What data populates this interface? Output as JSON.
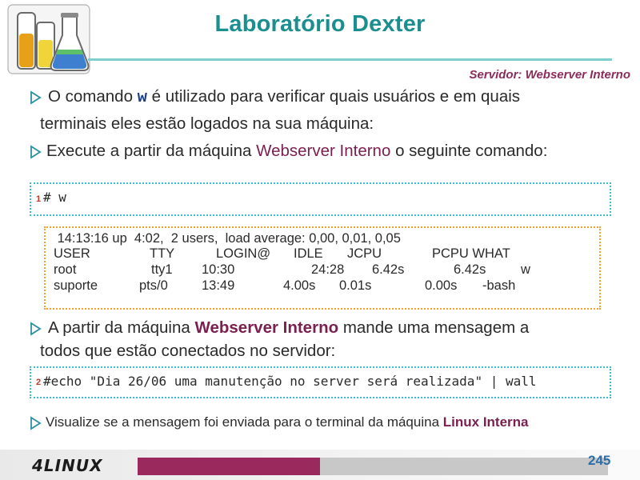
{
  "title": "Laboratório Dexter",
  "server_label": "Servidor: Webserver Interno",
  "bullets": {
    "b1": {
      "pre": "O comando ",
      "cmd": "w",
      "post1": " é utilizado para verificar quais usuários e em quais",
      "line2": "terminais eles estão logados na sua máquina:"
    },
    "b2": {
      "pre": "Execute a partir da máquina ",
      "highlight": "Webserver Interno",
      "post": " o seguinte comando:"
    },
    "b3": {
      "pre": "A partir da máquina  ",
      "highlight": "Webserver Interno",
      "post": " mande uma mensagem a",
      "line2": "todos que estão conectados no servidor:"
    },
    "b4": {
      "pre": "Visualize se a mensagem foi enviada para o terminal da máquina ",
      "highlight": "Linux Interna"
    }
  },
  "command1": {
    "number": "1",
    "code": "# w"
  },
  "output": {
    "header": " 14:13:16 up  4:02,  2 users,  load average: 0,00, 0,01, 0,05",
    "columns": [
      "USER",
      "TTY",
      "LOGIN@",
      "IDLE",
      "JCPU",
      "PCPU WHAT"
    ],
    "rows": [
      [
        "root",
        "tty1",
        "10:30",
        "24:28",
        "6.42s",
        "6.42s",
        "w"
      ],
      [
        "suporte",
        "pts/0",
        "13:49",
        "4.00s",
        "0.01s",
        "0.00s",
        "-bash"
      ]
    ]
  },
  "command2": {
    "number": "2",
    "code": "#echo \"Dia 26/06 uma manutenção no server será realizada\" | wall"
  },
  "footer": {
    "logo_text": "4LINUX",
    "page_number": "245"
  },
  "colors": {
    "title": "#1b8f8f",
    "accent": "#7a1f4f",
    "cmd_border": "#3bbcc8",
    "output_border": "#f0a030"
  },
  "icons": {
    "logo": "lab-flasks-icon",
    "bullet": "arrow-bullet-icon"
  }
}
